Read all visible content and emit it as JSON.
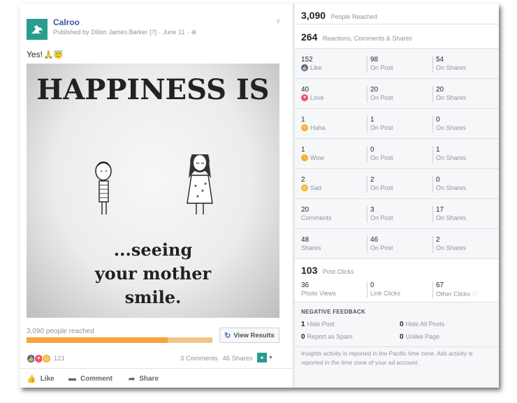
{
  "post": {
    "page_name": "Calroo",
    "byline_prefix": "Published by",
    "author": "Dillon James Barker",
    "help_marker": "[?]",
    "date": "June 11",
    "separator": "·",
    "text": "Yes!",
    "text_emojis": "🙏😇",
    "image": {
      "headline": "HAPPINESS IS",
      "caption_line1": "...seeing",
      "caption_line2": "your mother",
      "caption_line3": "smile."
    },
    "reach_label": "3,090 people reached",
    "reach_fill_fraction": 0.76,
    "view_results_label": "View Results",
    "reaction_count": "121",
    "comments_label": "3 Comments",
    "shares_label": "46 Shares",
    "actions": {
      "like": "Like",
      "comment": "Comment",
      "share": "Share"
    }
  },
  "insights": {
    "people_reached": {
      "value": "3,090",
      "label": "People Reached"
    },
    "engagement": {
      "value": "264",
      "label": "Reactions, Comments & Shares"
    },
    "rows": [
      {
        "total": "152",
        "label": "Like",
        "icon": "like-icon",
        "on_post": "98",
        "on_shares": "54"
      },
      {
        "total": "40",
        "label": "Love",
        "icon": "love-icon",
        "on_post": "20",
        "on_shares": "20"
      },
      {
        "total": "1",
        "label": "Haha",
        "icon": "haha-icon",
        "on_post": "1",
        "on_shares": "0"
      },
      {
        "total": "1",
        "label": "Wow",
        "icon": "wow-icon",
        "on_post": "0",
        "on_shares": "1"
      },
      {
        "total": "2",
        "label": "Sad",
        "icon": "sad-icon",
        "on_post": "2",
        "on_shares": "0"
      },
      {
        "total": "20",
        "label": "Comments",
        "icon": "",
        "on_post": "3",
        "on_shares": "17"
      },
      {
        "total": "48",
        "label": "Shares",
        "icon": "",
        "on_post": "46",
        "on_shares": "2"
      }
    ],
    "on_post_label": "On Post",
    "on_shares_label": "On Shares",
    "post_clicks": {
      "value": "103",
      "label": "Post Clicks"
    },
    "clicks": [
      {
        "value": "36",
        "label": "Photo Views"
      },
      {
        "value": "0",
        "label": "Link Clicks"
      },
      {
        "value": "67",
        "label": "Other Clicks"
      }
    ],
    "negative_title": "NEGATIVE FEEDBACK",
    "negative": [
      {
        "value": "1",
        "label": "Hide Post"
      },
      {
        "value": "0",
        "label": "Hide All Posts"
      },
      {
        "value": "0",
        "label": "Report as Spam"
      },
      {
        "value": "0",
        "label": "Unlike Page"
      }
    ],
    "footnote": "Insights activity is reported in the Pacific time zone. Ads activity is reported in the time zone of your ad account."
  },
  "colors": {
    "link": "#365899",
    "accent": "#4267b2",
    "reach_bar": "#f6a33a",
    "brand": "#2a9d8f"
  }
}
